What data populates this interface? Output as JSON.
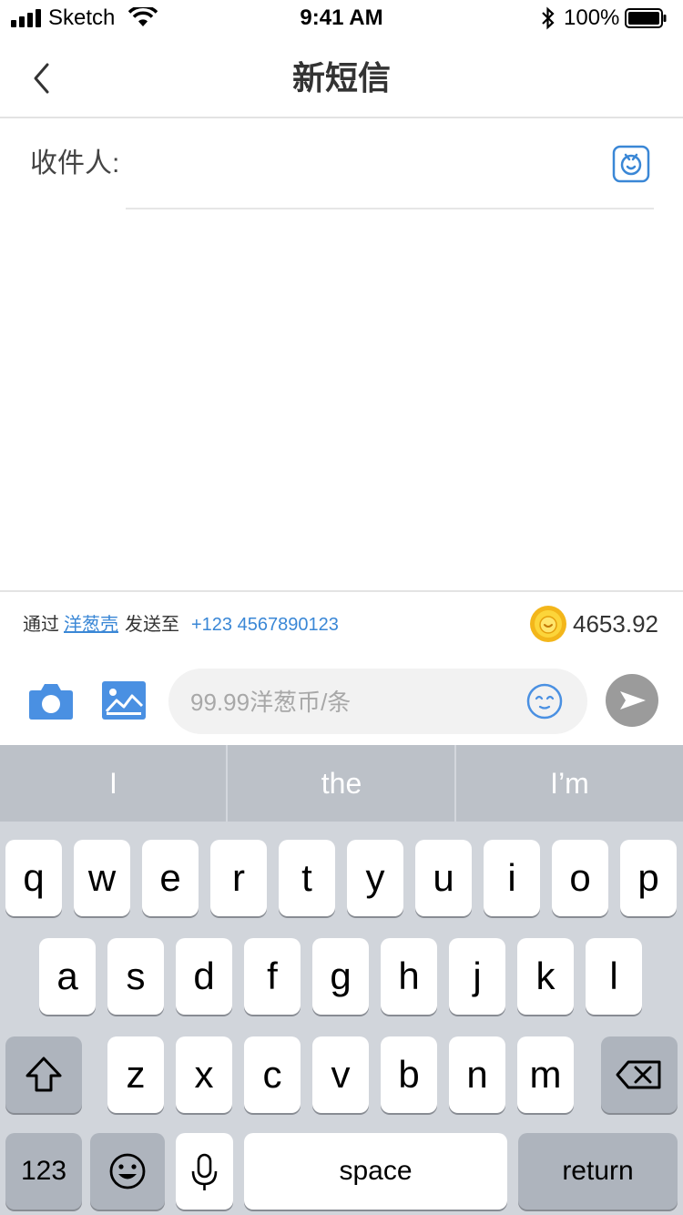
{
  "status_bar": {
    "carrier": "Sketch",
    "time": "9:41 AM",
    "battery": "100%"
  },
  "nav": {
    "title": "新短信",
    "back_icon": "chevron-left-icon"
  },
  "recipient": {
    "label": "收件人:",
    "value": "",
    "contact_icon": "contact-book-icon"
  },
  "info_bar": {
    "via": "通过",
    "app_link": "洋葱壳",
    "send_to": "发送至",
    "phone": "+123 4567890123",
    "coin_icon": "coin-icon",
    "balance": "4653.92"
  },
  "compose": {
    "camera_icon": "camera-icon",
    "image_icon": "image-icon",
    "placeholder": "99.99洋葱币/条",
    "emoji_icon": "emoji-icon",
    "send_icon": "send-icon"
  },
  "keyboard": {
    "suggestions": [
      "I",
      "the",
      "I’m"
    ],
    "row1": [
      "q",
      "w",
      "e",
      "r",
      "t",
      "y",
      "u",
      "i",
      "o",
      "p"
    ],
    "row2": [
      "a",
      "s",
      "d",
      "f",
      "g",
      "h",
      "j",
      "k",
      "l"
    ],
    "row3": [
      "z",
      "x",
      "c",
      "v",
      "b",
      "n",
      "m"
    ],
    "numbers_key": "123",
    "space_key": "space",
    "return_key": "return"
  },
  "colors": {
    "accent": "#3a87d6",
    "send_button": "#9b9b9b",
    "keyboard_bg": "#d1d5db",
    "suggestion_bg": "#bcc1c8"
  }
}
